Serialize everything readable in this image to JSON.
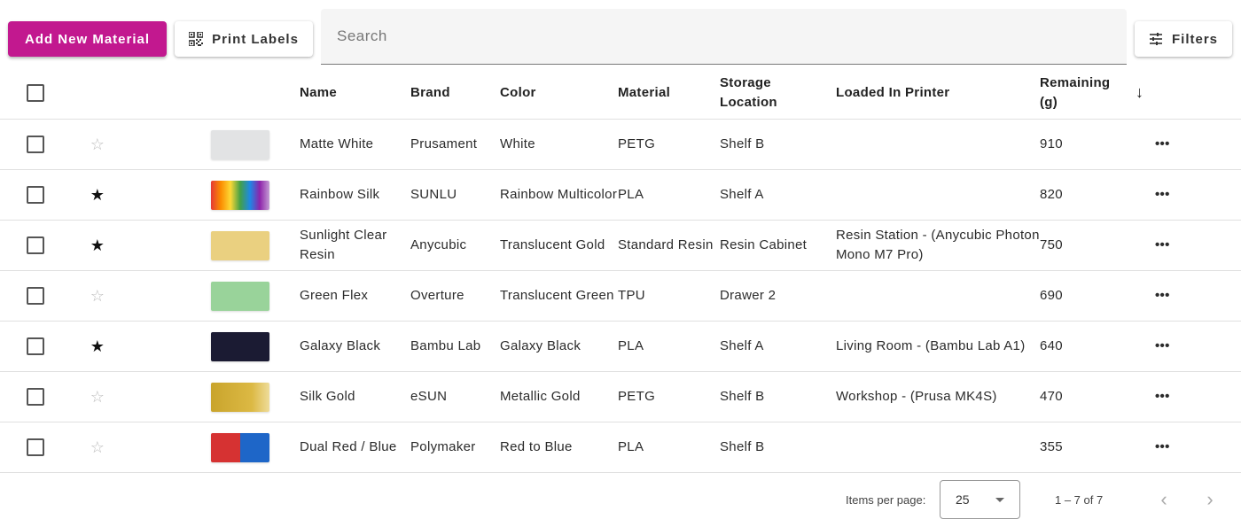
{
  "toolbar": {
    "add_label": "Add New Material",
    "print_label": "Print Labels",
    "search_placeholder": "Search",
    "filters_label": "Filters"
  },
  "columns": {
    "name": "Name",
    "brand": "Brand",
    "color": "Color",
    "material": "Material",
    "storage_line1": "Storage",
    "storage_line2": "Location",
    "loaded": "Loaded In Printer",
    "remaining_line1": "Remaining",
    "remaining_line2": "(g)"
  },
  "rows": [
    {
      "favorite": false,
      "swatch": "linear-gradient(#e2e3e4,#e2e3e4)",
      "name": "Matte White",
      "brand": "Prusament",
      "color": "White",
      "material": "PETG",
      "storage": "Shelf B",
      "loaded": "",
      "remaining": "910"
    },
    {
      "favorite": true,
      "swatch": "linear-gradient(90deg,#e53935,#fb8c00,#fdd835,#43a047,#1e88e5,#8e24aa,#c39bd3)",
      "name": "Rainbow Silk",
      "brand": "SUNLU",
      "color": "Rainbow Multicolor",
      "material": "PLA",
      "storage": "Shelf A",
      "loaded": "",
      "remaining": "820"
    },
    {
      "favorite": true,
      "swatch": "linear-gradient(#ead080,#ead080)",
      "name": "Sunlight Clear Resin",
      "brand": "Anycubic",
      "color": "Translucent Gold",
      "material": "Standard Resin",
      "storage": "Resin Cabinet",
      "loaded": "Resin Station - (Anycubic Photon Mono M7 Pro)",
      "remaining": "750"
    },
    {
      "favorite": false,
      "swatch": "linear-gradient(#99d39a,#99d39a)",
      "name": "Green Flex",
      "brand": "Overture",
      "color": "Translucent Green",
      "material": "TPU",
      "storage": "Drawer 2",
      "loaded": "",
      "remaining": "690"
    },
    {
      "favorite": true,
      "swatch": "linear-gradient(#1b1b33,#1b1b33)",
      "name": "Galaxy Black",
      "brand": "Bambu Lab",
      "color": "Galaxy Black",
      "material": "PLA",
      "storage": "Shelf A",
      "loaded": "Living Room - (Bambu Lab A1)",
      "remaining": "640"
    },
    {
      "favorite": false,
      "swatch": "linear-gradient(90deg,#c9a42c,#dcb944 70%,#eedc9a)",
      "name": "Silk Gold",
      "brand": "eSUN",
      "color": "Metallic Gold",
      "material": "PETG",
      "storage": "Shelf B",
      "loaded": "Workshop - (Prusa MK4S)",
      "remaining": "470"
    },
    {
      "favorite": false,
      "swatch": "linear-gradient(90deg,#d63232 50%,#1e66c8 50%)",
      "name": "Dual Red / Blue",
      "brand": "Polymaker",
      "color": "Red to Blue",
      "material": "PLA",
      "storage": "Shelf B",
      "loaded": "",
      "remaining": "355"
    }
  ],
  "paginator": {
    "items_per_page_label": "Items per page:",
    "page_size": "25",
    "range": "1 – 7 of 7"
  },
  "icons": {
    "star_on": "★",
    "star_off": "☆",
    "more": "•••",
    "sort_desc": "↓",
    "prev": "‹",
    "next": "›"
  }
}
